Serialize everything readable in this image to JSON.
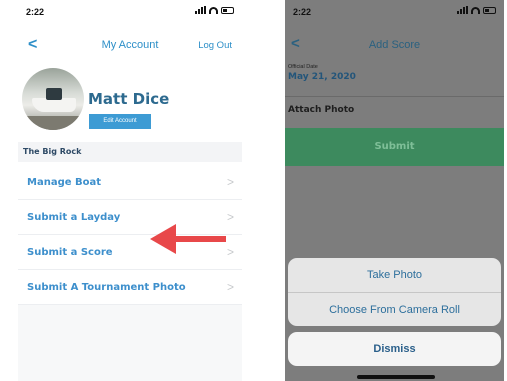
{
  "left": {
    "status_time": "2:22",
    "nav": {
      "back": "<",
      "title": "My Account",
      "logout": "Log Out"
    },
    "profile": {
      "name": "Matt Dice",
      "edit_label": "Edit Account"
    },
    "section": "The Big Rock",
    "menu": [
      {
        "label": "Manage Boat",
        "chevron": ">"
      },
      {
        "label": "Submit a Layday",
        "chevron": ">"
      },
      {
        "label": "Submit a Score",
        "chevron": ">"
      },
      {
        "label": "Submit A Tournament Photo",
        "chevron": ">"
      }
    ]
  },
  "right": {
    "status_time": "2:22",
    "nav": {
      "back": "<",
      "title": "Add Score"
    },
    "official_date": {
      "caption": "Official Date",
      "value": "May 21, 2020"
    },
    "attach_label": "Attach Photo",
    "submit_label": "Submit",
    "sheet": {
      "take_photo": "Take Photo",
      "camera_roll": "Choose From Camera Roll",
      "dismiss": "Dismiss"
    }
  },
  "colors": {
    "accent": "#3d8fcc",
    "arrow": "#e8484a",
    "submit_bg": "#3d8a5e",
    "overlay": "#7d7d7d"
  },
  "icons": [
    "location-arrow-icon",
    "signal-icon",
    "wifi-icon",
    "battery-icon",
    "chevron-left-icon",
    "chevron-right-icon",
    "red-arrow-icon"
  ]
}
